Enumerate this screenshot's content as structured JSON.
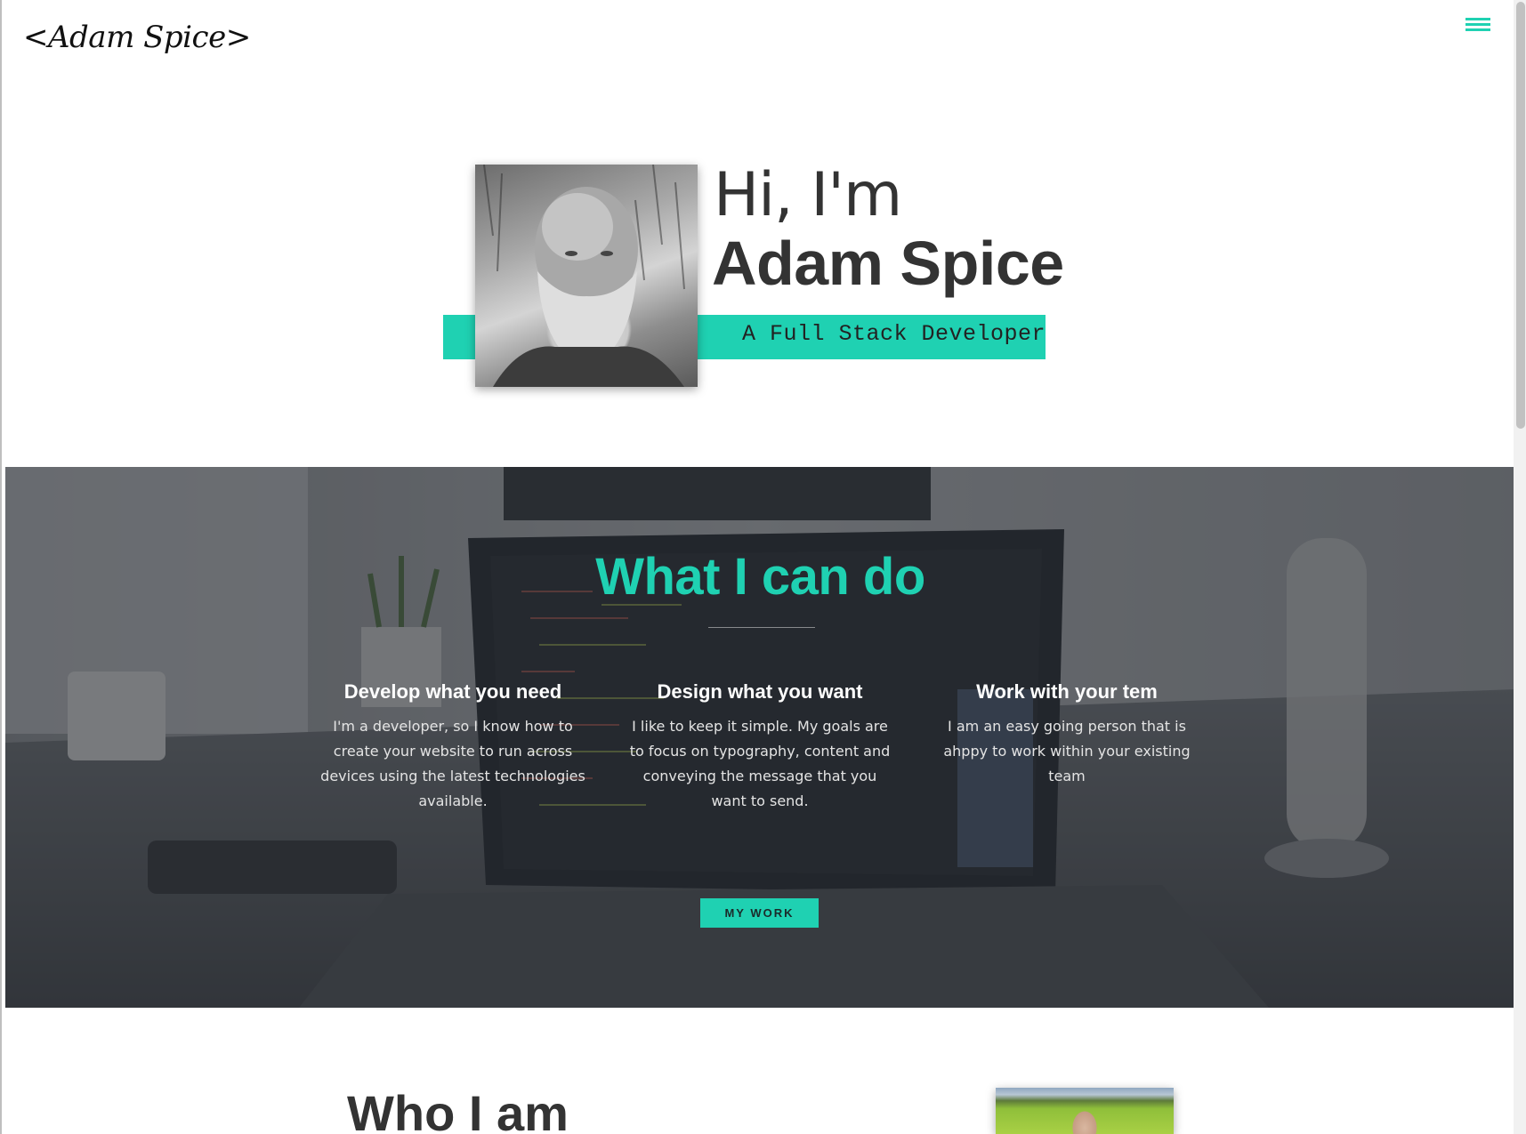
{
  "header": {
    "logo": "<Adam Spice>",
    "menu_icon": "hamburger-menu-icon"
  },
  "hero": {
    "greeting": "Hi, I'm",
    "name": "Adam Spice",
    "tagline": "A Full Stack Developer"
  },
  "services": {
    "title": "What I can do",
    "items": [
      {
        "heading": "Develop what you need",
        "text": "I'm a developer, so I know how to create your website to run across devices using the latest technologies available."
      },
      {
        "heading": "Design what you want",
        "text": "I like to keep it simple. My goals are to focus on typography, content and conveying the message that you want to send."
      },
      {
        "heading": "Work with your tem",
        "text": "I am an easy going person that is ahppy to work within your existing team"
      }
    ],
    "cta_label": "MY WORK"
  },
  "about": {
    "title": "Who I am"
  },
  "colors": {
    "accent": "#1fd1b2",
    "text_dark": "#333333"
  }
}
